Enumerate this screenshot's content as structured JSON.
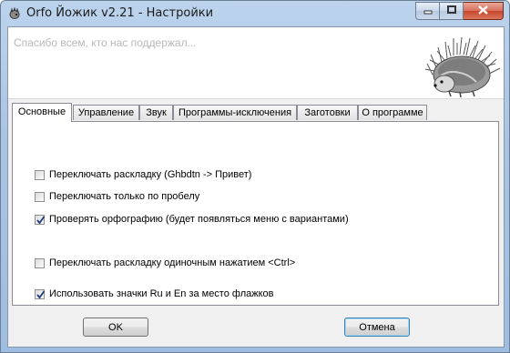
{
  "window": {
    "title": "Orfo Йожик v2.21 - Настройки",
    "app_icon": "hedgehog-app-icon",
    "controls": [
      "minimize-icon",
      "maximize-icon",
      "close-icon"
    ]
  },
  "banner": {
    "thanks_text": "Спасибо всем, кто нас поддержал...",
    "image": "hedgehog-image"
  },
  "tabs": [
    {
      "label": "Основные",
      "active": true
    },
    {
      "label": "Управление",
      "active": false
    },
    {
      "label": "Звук",
      "active": false
    },
    {
      "label": "Программы-исключения",
      "active": false
    },
    {
      "label": "Заготовки",
      "active": false
    },
    {
      "label": "О программе",
      "active": false
    }
  ],
  "options": [
    {
      "label": "Переключать раскладку (Ghbdtn -> Привет)",
      "checked": false
    },
    {
      "label": "Переключать только по пробелу",
      "checked": false
    },
    {
      "label": "Проверять орфографию (будет появляться меню с вариантами)",
      "checked": true
    },
    {
      "label": "Переключать раскладку одиночным нажатием <Ctrl>",
      "checked": false
    },
    {
      "label": "Использовать значки Ru и En за место флажков",
      "checked": true
    }
  ],
  "buttons": {
    "ok": "OK",
    "cancel": "Отмена"
  }
}
